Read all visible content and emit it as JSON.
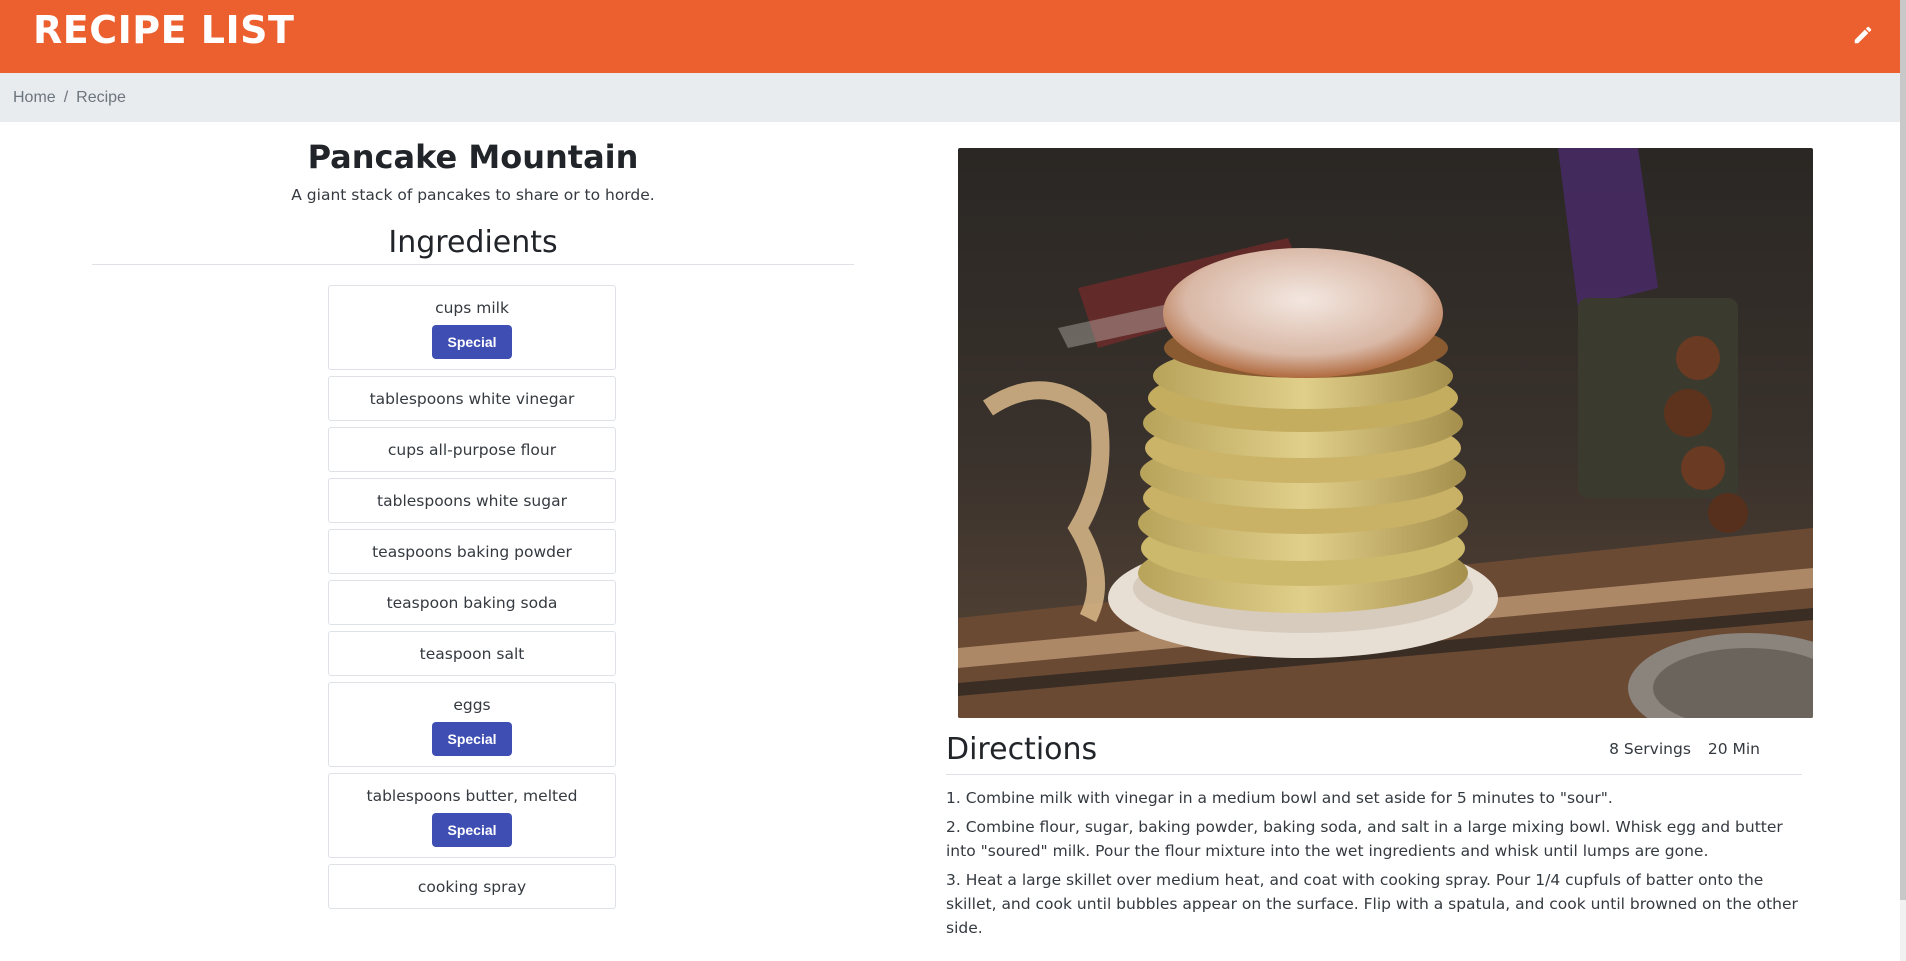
{
  "header": {
    "title": "RECIPE LIST",
    "edit_icon": "pencil-icon",
    "color": "#ec5f2e"
  },
  "breadcrumb": {
    "items": [
      "Home",
      "Recipe"
    ],
    "separator": "/"
  },
  "recipe": {
    "title": "Pancake Mountain",
    "description": "A giant stack of pancakes to share or to horde."
  },
  "ingredients": {
    "heading": "Ingredients",
    "items": [
      {
        "name": "cups milk",
        "badge": "Special"
      },
      {
        "name": "tablespoons white vinegar",
        "badge": ""
      },
      {
        "name": "cups all-purpose flour",
        "badge": ""
      },
      {
        "name": "tablespoons white sugar",
        "badge": ""
      },
      {
        "name": "teaspoons baking powder",
        "badge": ""
      },
      {
        "name": "teaspoon baking soda",
        "badge": ""
      },
      {
        "name": "teaspoon salt",
        "badge": ""
      },
      {
        "name": "eggs",
        "badge": "Special"
      },
      {
        "name": "tablespoons butter, melted",
        "badge": "Special"
      },
      {
        "name": "cooking spray",
        "badge": ""
      }
    ]
  },
  "directions": {
    "heading": "Directions",
    "servings": "8 Servings",
    "time": "20 Min",
    "steps": [
      "1. Combine milk with vinegar in a medium bowl and set aside for 5 minutes to \"sour\".",
      "2. Combine flour, sugar, baking powder, baking soda, and salt in a large mixing bowl. Whisk egg and butter into \"soured\" milk. Pour the flour mixture into the wet ingredients and whisk until lumps are gone.",
      "3. Heat a large skillet over medium heat, and coat with cooking spray. Pour 1/4 cupfuls of batter onto the skillet, and cook until bubbles appear on the surface. Flip with a spatula, and cook until browned on the other side."
    ]
  },
  "colors": {
    "badge": "#3f4eb3",
    "breadcrumb_bg": "#e9ecef"
  }
}
